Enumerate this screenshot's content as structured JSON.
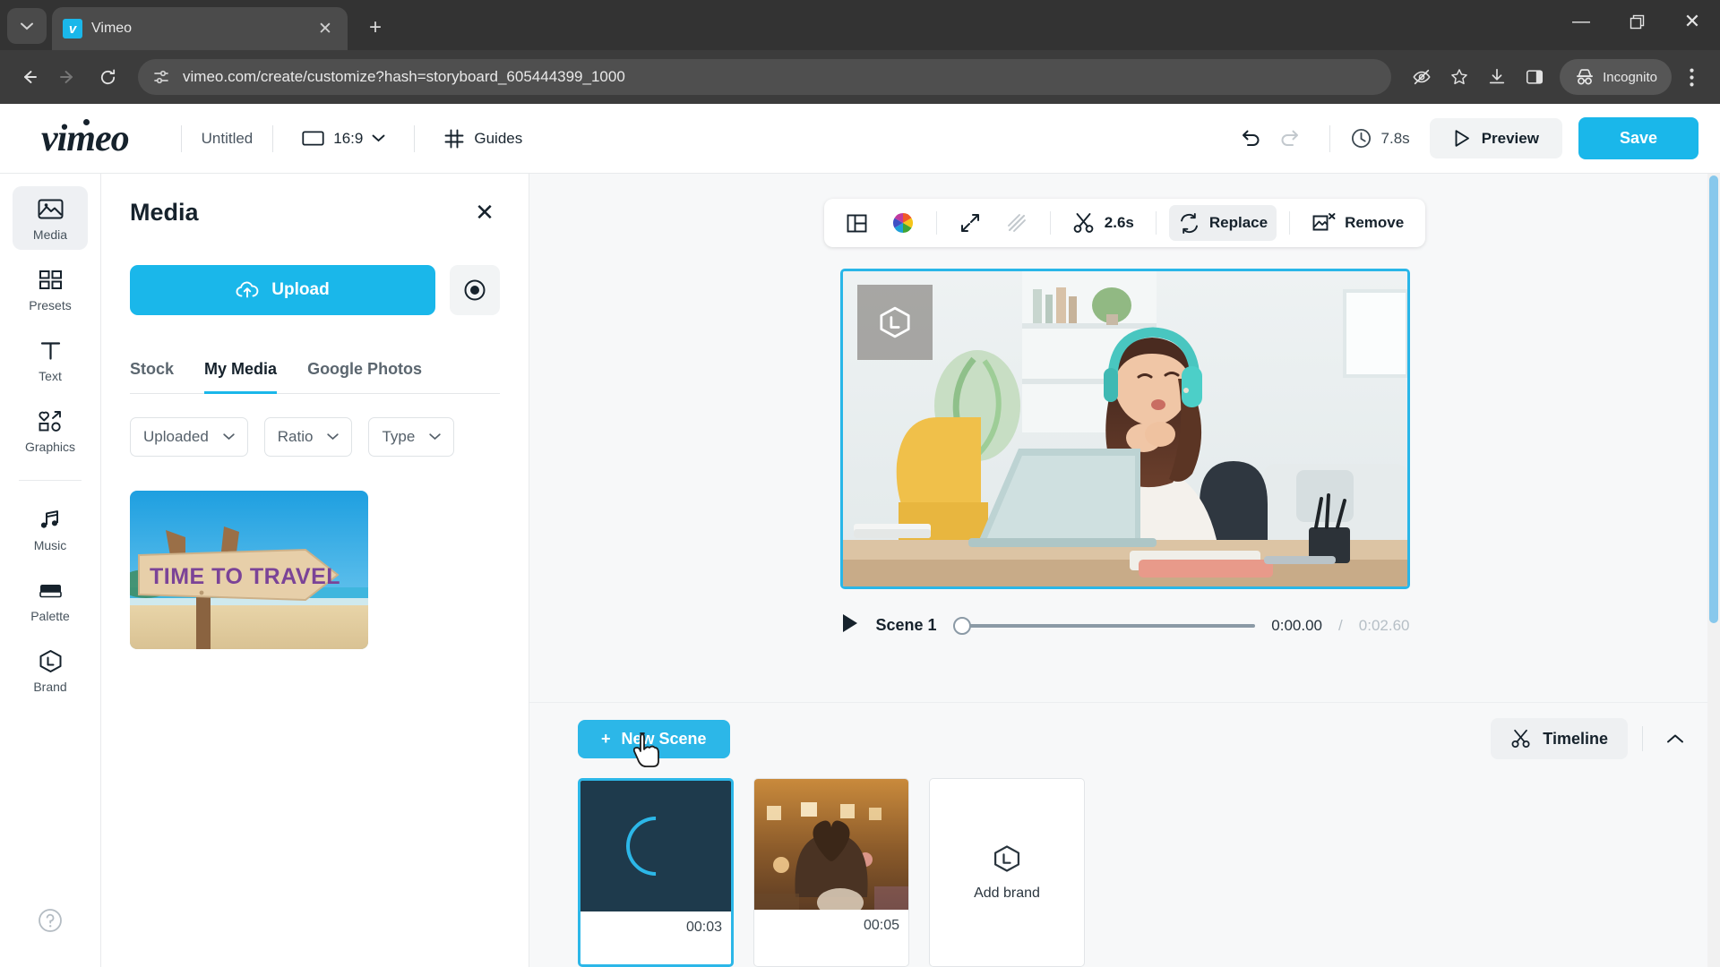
{
  "browser": {
    "tab": {
      "title": "Vimeo",
      "favicon_letter": "v"
    },
    "url": "vimeo.com/create/customize?hash=storyboard_605444399_1000",
    "profile_label": "Incognito",
    "icons": {
      "tab_search": "chevron-down-icon",
      "new_tab": "plus-icon",
      "back": "back-arrow-icon",
      "forward": "forward-arrow-icon",
      "reload": "reload-icon",
      "site_info": "page-settings-icon",
      "tracking": "eye-off-icon",
      "bookmark": "star-icon",
      "downloads": "download-icon",
      "side_panel": "side-panel-icon",
      "incognito": "incognito-hat-icon",
      "menu": "three-dot-menu-icon",
      "minimize": "minimize-icon",
      "maximize": "restore-window-icon",
      "close": "close-window-icon"
    }
  },
  "header": {
    "logo": "vimeo",
    "project_title": "Untitled",
    "aspect_ratio": "16:9",
    "guides_label": "Guides",
    "duration": "7.8s",
    "preview_label": "Preview",
    "save_label": "Save"
  },
  "rail": {
    "items": [
      {
        "label": "Media",
        "icon": "image-icon",
        "active": true
      },
      {
        "label": "Presets",
        "icon": "grid-icon",
        "active": false
      },
      {
        "label": "Text",
        "icon": "text-t-icon",
        "active": false
      },
      {
        "label": "Graphics",
        "icon": "shapes-icon",
        "active": false
      },
      {
        "label": "Music",
        "icon": "music-note-icon",
        "active": false
      },
      {
        "label": "Palette",
        "icon": "palette-icon",
        "active": false
      },
      {
        "label": "Brand",
        "icon": "brand-hex-icon",
        "active": false
      }
    ],
    "help_icon": "question-mark-icon"
  },
  "panel": {
    "title": "Media",
    "close_icon": "close-icon",
    "upload_label": "Upload",
    "record_icon": "record-icon",
    "tabs": [
      {
        "label": "Stock",
        "active": false
      },
      {
        "label": "My Media",
        "active": true
      },
      {
        "label": "Google Photos",
        "active": false
      }
    ],
    "filters": [
      {
        "label": "Uploaded"
      },
      {
        "label": "Ratio"
      },
      {
        "label": "Type"
      }
    ],
    "media_items": [
      {
        "alt": "TIME TO TRAVEL wooden sign on beach",
        "caption": "TIME TO TRAVEL"
      }
    ]
  },
  "stage": {
    "toolbar": [
      {
        "name": "layout",
        "icon": "layout-split-icon",
        "label": "",
        "state": "normal"
      },
      {
        "name": "color",
        "icon": "color-wheel-icon",
        "label": "",
        "state": "normal"
      },
      {
        "name": "resize",
        "icon": "expand-arrows-icon",
        "label": "",
        "state": "normal"
      },
      {
        "name": "filter",
        "icon": "no-filter-icon",
        "label": "",
        "state": "disabled"
      },
      {
        "name": "trim",
        "icon": "scissors-icon",
        "label": "2.6s",
        "state": "normal"
      },
      {
        "name": "replace",
        "icon": "refresh-icon",
        "label": "Replace",
        "state": "active"
      },
      {
        "name": "remove",
        "icon": "image-x-icon",
        "label": "Remove",
        "state": "normal"
      }
    ],
    "preview_alt": "Woman wearing teal headphones talking at a laptop in a bright living room",
    "logo_placeholder_icon": "brand-hex-icon",
    "playback": {
      "play_icon": "play-icon",
      "scene_label": "Scene 1",
      "current_time": "0:00.00",
      "separator": "/",
      "total_time": "0:02.60",
      "progress_percent": 0
    }
  },
  "timeline": {
    "new_scene_label": "New Scene",
    "new_scene_icon": "plus-icon",
    "timeline_label": "Timeline",
    "timeline_icon": "scissors-icon",
    "collapse_icon": "chevron-up-icon",
    "scenes": [
      {
        "duration": "00:03",
        "selected": true,
        "state": "loading",
        "alt": "Scene loading"
      },
      {
        "duration": "00:05",
        "selected": false,
        "state": "ready",
        "alt": "Hands forming heart at a concert"
      }
    ],
    "add_brand": {
      "label": "Add brand",
      "icon": "brand-hex-icon"
    }
  },
  "colors": {
    "accent": "#1ab7ea",
    "accent_selected": "#2cb7e8",
    "text_dark": "#16222c",
    "browser_chrome": "#3c3c3c",
    "stage_bg": "#f7f8f9"
  }
}
